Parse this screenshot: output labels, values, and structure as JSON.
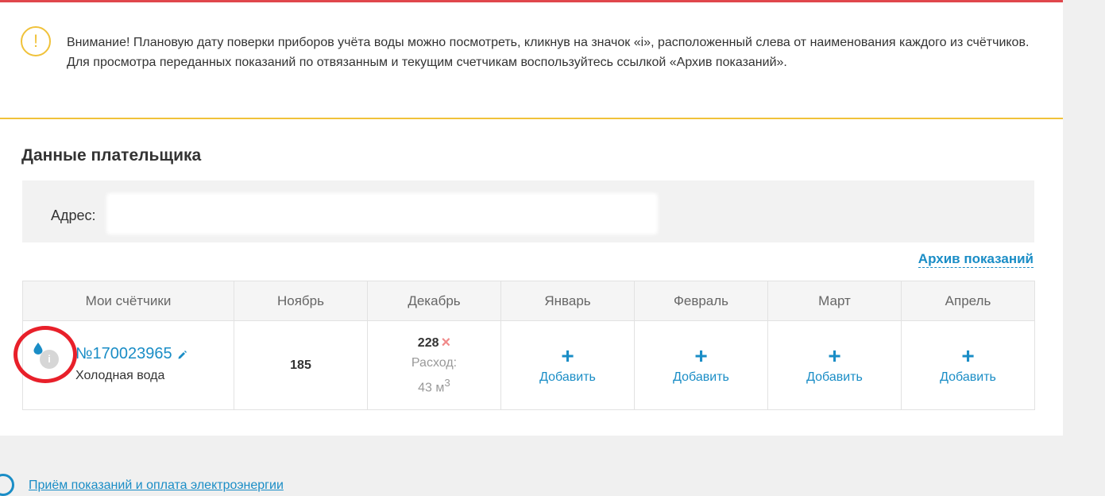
{
  "notice": {
    "line1": "Внимание! Плановую дату поверки приборов учёта воды можно посмотреть, кликнув на значок «i», расположенный слева от наименования каждого из счётчиков.",
    "line2": "Для просмотра переданных показаний по отвязанным и текущим счетчикам воспользуйтесь ссылкой «Архив показаний».",
    "icon": "warning-icon",
    "accent": "#f0c23a"
  },
  "section": {
    "title": "Данные плательщика"
  },
  "address": {
    "label": "Адрес:"
  },
  "archive_link": "Архив показаний",
  "table": {
    "headers": [
      "Мои счётчики",
      "Ноябрь",
      "Декабрь",
      "Январь",
      "Февраль",
      "Март",
      "Апрель"
    ],
    "meter": {
      "number": "№170023965",
      "type": "Холодная вода",
      "info_icon_label": "i"
    },
    "november": {
      "reading": "185"
    },
    "december": {
      "reading": "228",
      "delete_symbol": "×",
      "consumption_label": "Расход:",
      "consumption_value": "43 м",
      "consumption_unit_sup": "3"
    },
    "add_symbol": "+",
    "add_label": "Добавить"
  },
  "footer": {
    "link": "Приём показаний и оплата электроэнергии"
  },
  "colors": {
    "top_rule": "#e0474c",
    "link": "#1a8dc6",
    "highlight_circle": "#e8202a"
  }
}
